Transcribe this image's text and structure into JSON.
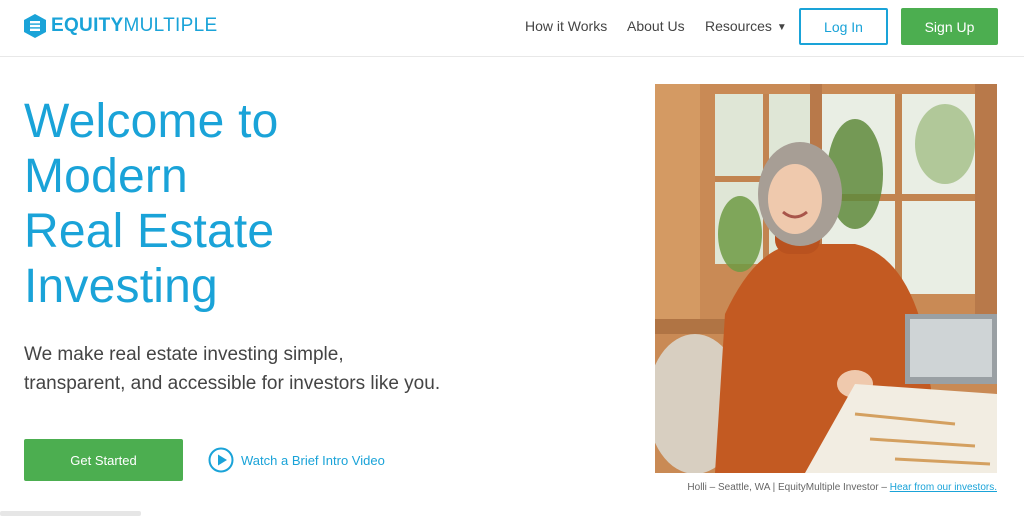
{
  "brand": {
    "name_bold": "EQUITY",
    "name_light": "MULTIPLE",
    "color": "#1aa3d8"
  },
  "nav": {
    "how_it_works": "How it Works",
    "about_us": "About Us",
    "resources": "Resources",
    "resources_icon": "caret-down-icon",
    "login": "Log In",
    "signup": "Sign Up"
  },
  "hero": {
    "title_lines": [
      "Welcome to",
      "Modern",
      "Real Estate",
      "Investing"
    ],
    "subtitle_lines": [
      "We make real estate investing simple,",
      "transparent, and accessible for investors like you."
    ],
    "cta": "Get Started",
    "video_link": "Watch a Brief Intro Video",
    "video_icon": "play-circle-icon"
  },
  "photo": {
    "caption": "Holli – Seattle, WA | EquityMultiple Investor – ",
    "caption_link": "Hear from our investors."
  },
  "colors": {
    "accent": "#1aa3d8",
    "green": "#4cae50",
    "text": "#444444"
  }
}
